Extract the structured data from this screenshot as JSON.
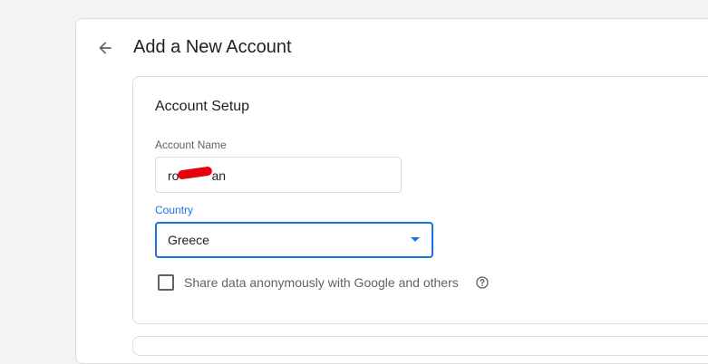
{
  "header": {
    "title": "Add a New Account",
    "back_icon": "arrow-back-icon"
  },
  "account_setup": {
    "section_title": "Account Setup",
    "account_name": {
      "label": "Account Name",
      "value": "ro",
      "value_suffix": "an"
    },
    "country": {
      "label": "Country",
      "selected": "Greece"
    },
    "share_data": {
      "label": "Share data anonymously with Google and others",
      "checked": false,
      "help_icon": "help-circle-icon"
    }
  },
  "colors": {
    "accent": "#1a73e8",
    "redaction": "#e8000b"
  }
}
